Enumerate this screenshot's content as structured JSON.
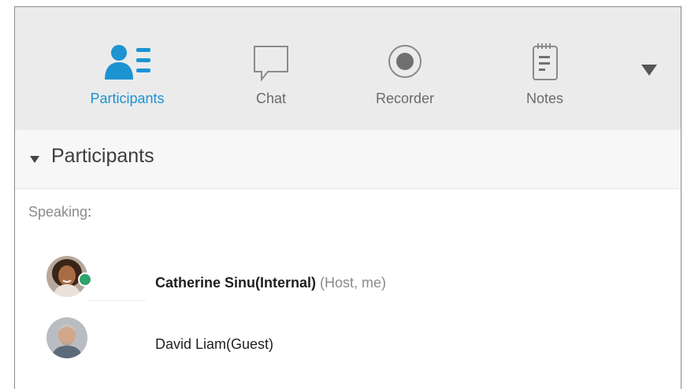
{
  "tabs": [
    {
      "label": "Participants",
      "icon": "participants-icon",
      "active": true
    },
    {
      "label": "Chat",
      "icon": "chat-icon",
      "active": false
    },
    {
      "label": "Recorder",
      "icon": "recorder-icon",
      "active": false
    },
    {
      "label": "Notes",
      "icon": "notes-icon",
      "active": false
    }
  ],
  "more_icon": "chevron-down-icon",
  "section": {
    "title": "Participants",
    "collapse_icon": "caret-down-icon"
  },
  "speaking": {
    "label": "Speaking",
    "colon": ":"
  },
  "participants": [
    {
      "name": "Catherine Sinu(Internal)",
      "role": "(Host, me)",
      "bold": true,
      "avatar": "avatar-catherine",
      "presence": "presence-icon"
    },
    {
      "name": "David Liam(Guest)",
      "role": "",
      "bold": false,
      "avatar": "avatar-david"
    }
  ],
  "colors": {
    "accent": "#1d93d2",
    "tabbar_bg": "#ebebeb",
    "presence": "#2fa36b"
  }
}
